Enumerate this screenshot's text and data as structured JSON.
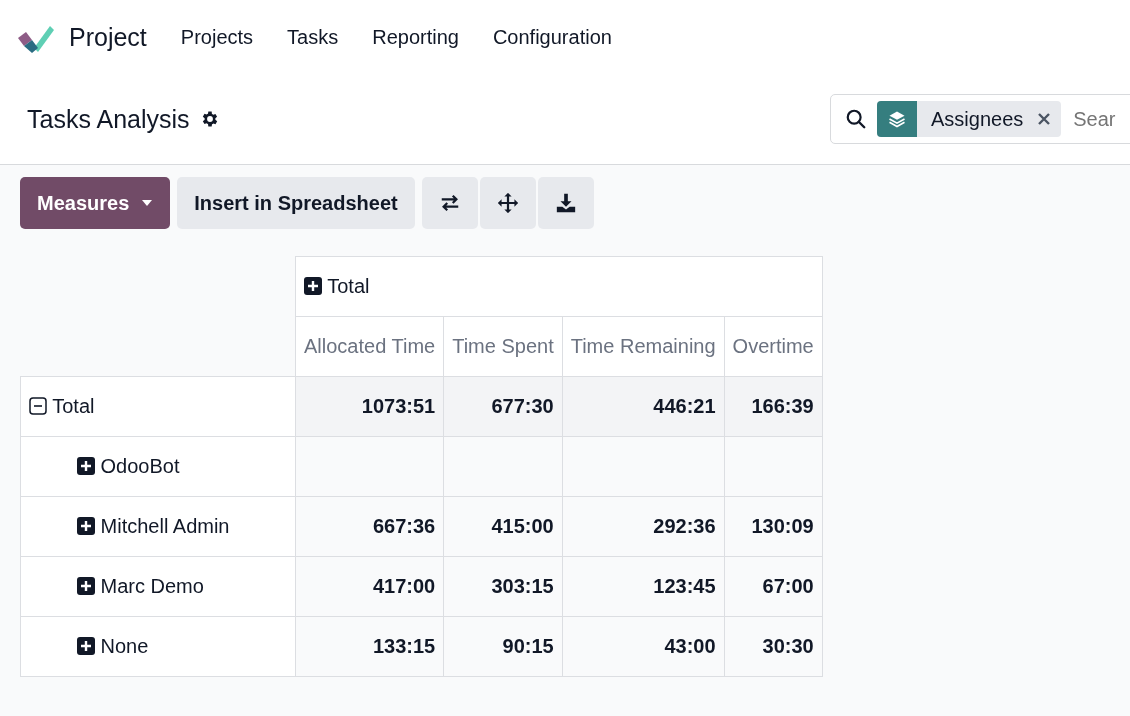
{
  "app": {
    "title": "Project"
  },
  "menu": [
    {
      "label": "Projects"
    },
    {
      "label": "Tasks"
    },
    {
      "label": "Reporting"
    },
    {
      "label": "Configuration"
    }
  ],
  "page": {
    "title": "Tasks Analysis"
  },
  "search": {
    "facets": [
      {
        "label": "Assignees"
      }
    ],
    "placeholder": "Sear"
  },
  "toolbar": {
    "measures_label": "Measures",
    "insert_label": "Insert in Spreadsheet"
  },
  "pivot": {
    "column_group": {
      "label": "Total",
      "expanded": false
    },
    "measures": [
      "Allocated Time",
      "Time Spent",
      "Time Remaining",
      "Overtime"
    ],
    "rows": [
      {
        "label": "Total",
        "expanded": true,
        "values": [
          "1073:51",
          "677:30",
          "446:21",
          "166:39"
        ],
        "children": [
          {
            "label": "OdooBot",
            "expanded": false
          },
          {
            "label": "Mitchell Admin",
            "expanded": false,
            "values": [
              "667:36",
              "415:00",
              "292:36",
              "130:09"
            ]
          },
          {
            "label": "Marc Demo",
            "expanded": false,
            "values": [
              "417:00",
              "303:15",
              "123:45",
              "67:00"
            ]
          },
          {
            "label": "None",
            "expanded": false,
            "values": [
              "133:15",
              "90:15",
              "43:00",
              "30:30"
            ]
          }
        ]
      }
    ]
  }
}
